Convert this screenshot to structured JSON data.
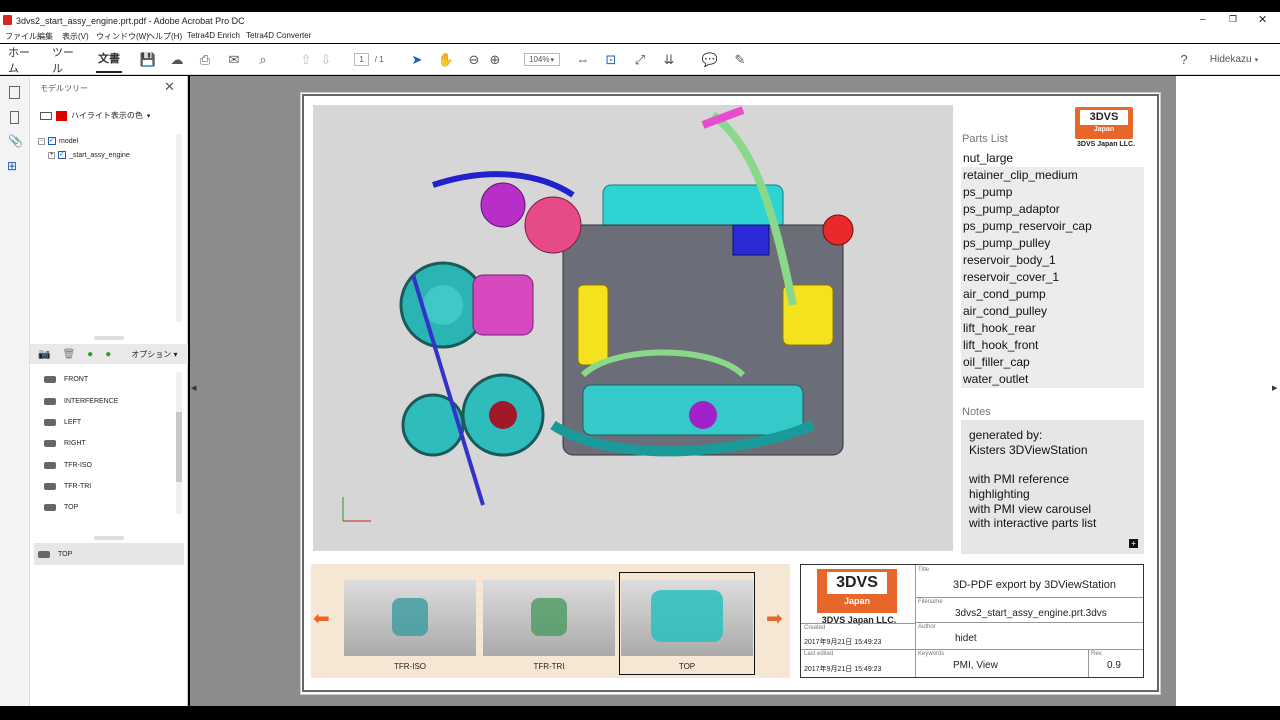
{
  "window": {
    "title": "3dvs2_start_assy_engine.prt.pdf - Adobe Acrobat Pro DC"
  },
  "menu": [
    "ファイル",
    "編集",
    "表示(V)",
    "ウィンドウ(W)",
    "ヘルプ(H)",
    "Tetra4D Enrich",
    "Tetra4D Converter"
  ],
  "nav": {
    "home": "ホーム",
    "tools": "ツール",
    "document": "文書"
  },
  "toolbar": {
    "page_current": "1",
    "page_total": "/ 1",
    "zoom": "104%",
    "user": "Hidekazu"
  },
  "panel": {
    "title": "モデルツリー",
    "highlight_label": "ハイライト表示の色",
    "tree": [
      {
        "label": "model"
      },
      {
        "label": "_start_assy_engine"
      }
    ],
    "options_label": "オプション",
    "views": [
      "FRONT",
      "INTERFERENCE",
      "LEFT",
      "RIGHT",
      "TFR-ISO",
      "TFR-TRI",
      "TOP"
    ],
    "bottom_view": "TOP"
  },
  "document": {
    "parts_heading": "Parts List",
    "parts": [
      "nut_large",
      "retainer_clip_medium",
      "ps_pump",
      "ps_pump_adaptor",
      "ps_pump_reservoir_cap",
      "ps_pump_pulley",
      "reservoir_body_1",
      "reservoir_cover_1",
      "air_cond_pump",
      "air_cond_pulley",
      "lift_hook_rear",
      "lift_hook_front",
      "oil_filler_cap",
      "water_outlet"
    ],
    "notes_heading": "Notes",
    "notes": [
      "generated by:",
      "Kisters 3DViewStation",
      "",
      "with PMI reference",
      "highlighting",
      "with PMI view carousel",
      "with interactive parts list"
    ],
    "logo_top": "3DVS",
    "logo_sub": "Japan",
    "logo_company": "3DVS Japan LLC.",
    "carousel": [
      "TFR-ISO",
      "TFR-TRI",
      "TOP"
    ],
    "titleblock": {
      "title_label": "Title",
      "title": "3D-PDF export by 3DViewStation",
      "filename_label": "Filename",
      "filename": "3dvs2_start_assy_engine.prt.3dvs",
      "created_label": "Created",
      "created": "2017年9月21日 15:49:23",
      "author_label": "Author",
      "author": "hidet",
      "lastedited_label": "Last edited",
      "lastedited": "2017年9月21日 15:49:23",
      "keywords_label": "Keywords",
      "keywords": "PMI, View",
      "rev_label": "Rev.",
      "rev": "0.9"
    }
  },
  "colors": {
    "accent": "#e8662a",
    "logo_red": "#e8662a",
    "highlight_red": "#e00000"
  }
}
